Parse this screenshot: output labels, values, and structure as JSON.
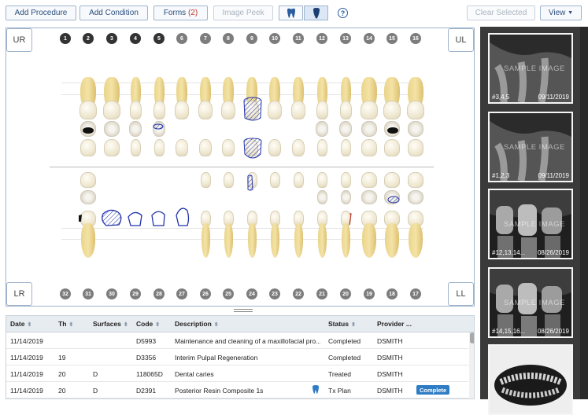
{
  "toolbar": {
    "add_procedure": "Add Procedure",
    "add_condition": "Add Condition",
    "forms_label": "Forms",
    "forms_count": "(2)",
    "image_peek": "Image Peek",
    "clear_selected": "Clear Selected",
    "view": "View",
    "help": "?"
  },
  "chart": {
    "corners": {
      "ur": "UR",
      "ul": "UL",
      "lr": "LR",
      "ll": "LL"
    },
    "upper_numbers": [
      "1",
      "2",
      "3",
      "4",
      "5",
      "6",
      "7",
      "8",
      "9",
      "10",
      "11",
      "12",
      "13",
      "14",
      "15",
      "16"
    ],
    "lower_numbers": [
      "32",
      "31",
      "30",
      "29",
      "28",
      "27",
      "26",
      "25",
      "24",
      "23",
      "22",
      "21",
      "20",
      "19",
      "18",
      "17"
    ]
  },
  "table": {
    "headers": [
      "Date",
      "Th",
      "Surfaces",
      "Code",
      "Description",
      "Status",
      "Provider ..."
    ],
    "rows": [
      {
        "date": "11/14/2019",
        "th": "",
        "surfaces": "",
        "code": "D5993",
        "description": "Maintenance and cleaning of a maxillofacial pro...",
        "status": "Completed",
        "provider": "DSMITH",
        "action": ""
      },
      {
        "date": "11/14/2019",
        "th": "19",
        "surfaces": "",
        "code": "D3356",
        "description": "Interim Pulpal Regeneration",
        "status": "Completed",
        "provider": "DSMITH",
        "action": ""
      },
      {
        "date": "11/14/2019",
        "th": "20",
        "surfaces": "D",
        "code": "118065D",
        "description": "Dental caries",
        "status": "Treated",
        "provider": "DSMITH",
        "action": ""
      },
      {
        "date": "11/14/2019",
        "th": "20",
        "surfaces": "D",
        "code": "D2391",
        "description": "Posterior Resin Composite 1s",
        "status": "Tx Plan",
        "provider": "DSMITH",
        "action": "Complete"
      }
    ]
  },
  "images": [
    {
      "teeth": "#3,4,5",
      "date": "09/11/2019",
      "watermark": "SAMPLE IMAGE"
    },
    {
      "teeth": "#1,2,3",
      "date": "09/11/2019",
      "watermark": "SAMPLE IMAGE"
    },
    {
      "teeth": "#12,13,14...",
      "date": "08/26/2019",
      "watermark": "SAMPLE IMAGE"
    },
    {
      "teeth": "#14,15,16...",
      "date": "08/26/2019",
      "watermark": "SAMPLE IMAGE"
    },
    {
      "teeth": "",
      "date": "",
      "watermark": ""
    }
  ],
  "colors": {
    "accent": "#2e7cc4",
    "border": "#9fb4cc",
    "sidebar": "#3a3a3a",
    "marking": "#2233aa"
  }
}
